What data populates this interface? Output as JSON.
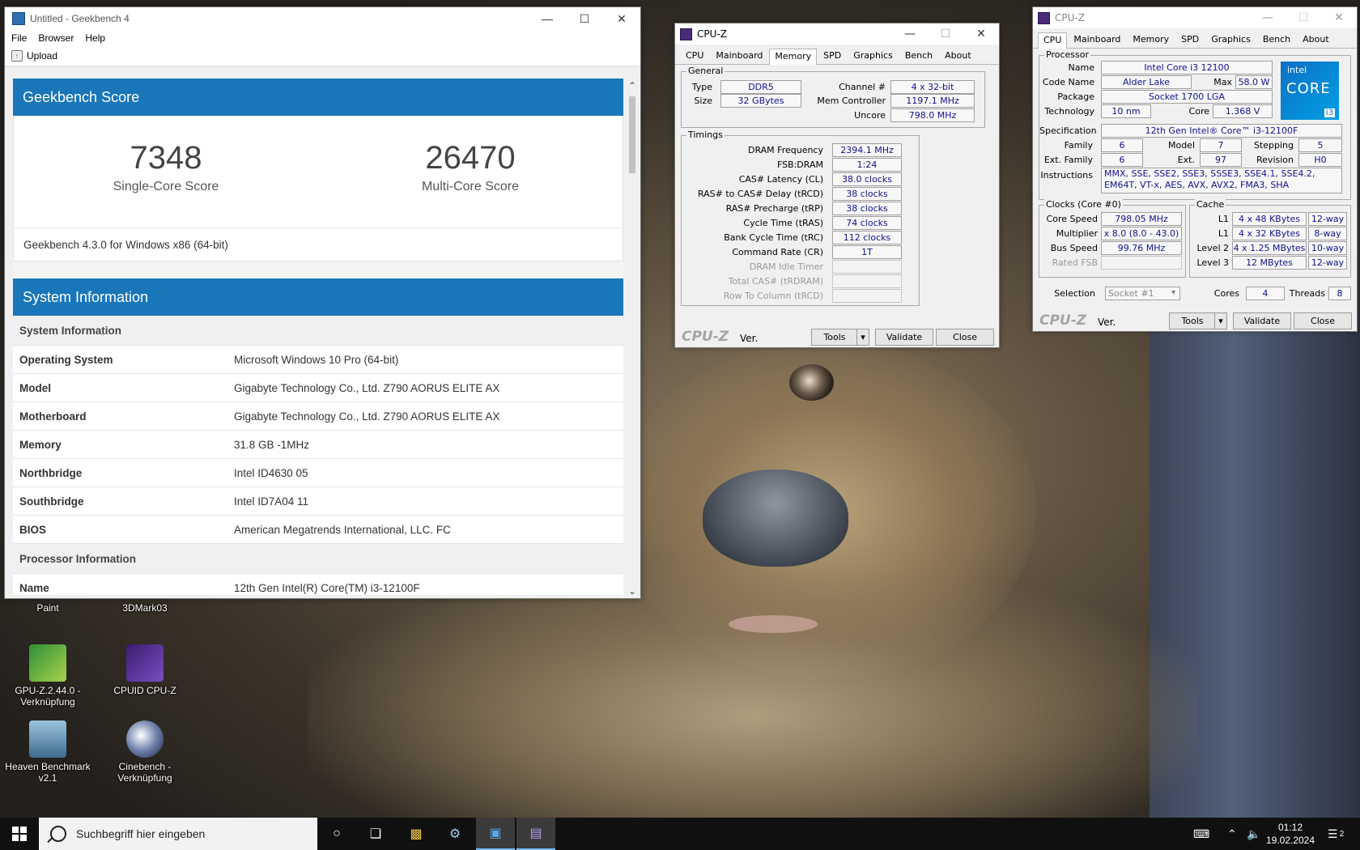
{
  "geekbench": {
    "window_title": "Untitled - Geekbench 4",
    "menu": [
      "File",
      "Browser",
      "Help"
    ],
    "upload_label": "Upload",
    "score_header": "Geekbench Score",
    "single_core_value": "7348",
    "single_core_label": "Single-Core Score",
    "multi_core_value": "26470",
    "multi_core_label": "Multi-Core Score",
    "version_text": "Geekbench 4.3.0 for Windows x86 (64-bit)",
    "sysinfo_header": "System Information",
    "sysinfo_group": "System Information",
    "rows": [
      {
        "key": "Operating System",
        "value": "Microsoft Windows 10 Pro (64-bit)"
      },
      {
        "key": "Model",
        "value": "Gigabyte Technology Co., Ltd. Z790 AORUS ELITE AX"
      },
      {
        "key": "Motherboard",
        "value": "Gigabyte Technology Co., Ltd. Z790 AORUS ELITE AX"
      },
      {
        "key": "Memory",
        "value": "31.8 GB -1MHz"
      },
      {
        "key": "Northbridge",
        "value": "Intel ID4630 05"
      },
      {
        "key": "Southbridge",
        "value": "Intel ID7A04 11"
      },
      {
        "key": "BIOS",
        "value": "American Megatrends International, LLC. FC"
      }
    ],
    "processor_group": "Processor Information",
    "processor_name_key": "Name",
    "processor_name_value": "12th Gen Intel(R) Core(TM) i3-12100F"
  },
  "cpuz_memory": {
    "title": "CPU-Z",
    "tabs": [
      "CPU",
      "Mainboard",
      "Memory",
      "SPD",
      "Graphics",
      "Bench",
      "About"
    ],
    "general_legend": "General",
    "type_label": "Type",
    "type_value": "DDR5",
    "size_label": "Size",
    "size_value": "32 GBytes",
    "channel_label": "Channel #",
    "channel_value": "4 x 32-bit",
    "memctrl_label": "Mem Controller",
    "memctrl_value": "1197.1 MHz",
    "uncore_label": "Uncore",
    "uncore_value": "798.0 MHz",
    "timings_legend": "Timings",
    "timings": [
      {
        "label": "DRAM Frequency",
        "value": "2394.1 MHz",
        "enabled": true
      },
      {
        "label": "FSB:DRAM",
        "value": "1:24",
        "enabled": true
      },
      {
        "label": "CAS# Latency (CL)",
        "value": "38.0 clocks",
        "enabled": true
      },
      {
        "label": "RAS# to CAS# Delay (tRCD)",
        "value": "38 clocks",
        "enabled": true
      },
      {
        "label": "RAS# Precharge (tRP)",
        "value": "38 clocks",
        "enabled": true
      },
      {
        "label": "Cycle Time (tRAS)",
        "value": "74 clocks",
        "enabled": true
      },
      {
        "label": "Bank Cycle Time (tRC)",
        "value": "112 clocks",
        "enabled": true
      },
      {
        "label": "Command Rate (CR)",
        "value": "1T",
        "enabled": true
      },
      {
        "label": "DRAM Idle Timer",
        "value": "",
        "enabled": false
      },
      {
        "label": "Total CAS# (tRDRAM)",
        "value": "",
        "enabled": false
      },
      {
        "label": "Row To Column (tRCD)",
        "value": "",
        "enabled": false
      }
    ],
    "logo": "CPU-Z",
    "ver_label": "Ver.",
    "tools_label": "Tools",
    "validate_label": "Validate",
    "close_label": "Close"
  },
  "cpuz_cpu": {
    "title": "CPU-Z",
    "tabs": [
      "CPU",
      "Mainboard",
      "Memory",
      "SPD",
      "Graphics",
      "Bench",
      "About"
    ],
    "processor_legend": "Processor",
    "name_label": "Name",
    "name_value": "Intel Core i3 12100",
    "codename_label": "Code Name",
    "codename_value": "Alder Lake",
    "maxtdp_label": "Max",
    "maxtdp_value": "58.0 W",
    "package_label": "Package",
    "package_value": "Socket 1700 LGA",
    "technology_label": "Technology",
    "technology_value": "10 nm",
    "corev_label": "Core",
    "corev_value": "1.368 V",
    "spec_label": "Specification",
    "spec_value": "12th Gen Intel® Core™ i3-12100F",
    "family_label": "Family",
    "family_value": "6",
    "model_label": "Model",
    "model_value": "7",
    "stepping_label": "Stepping",
    "stepping_value": "5",
    "extfamily_label": "Ext. Family",
    "extfamily_value": "6",
    "extmodel_label": "Ext.",
    "extmodel_value": "97",
    "revision_label": "Revision",
    "revision_value": "H0",
    "instr_label": "Instructions",
    "instr_line1": "MMX, SSE, SSE2, SSE3, SSSE3, SSE4.1, SSE4.2,",
    "instr_line2": "EM64T, VT-x, AES, AVX, AVX2, FMA3, SHA",
    "badge_brand": "intel",
    "badge_line": "CORE",
    "badge_tier": "i3",
    "clocks_legend": "Clocks (Core #0)",
    "corespeed_label": "Core Speed",
    "corespeed_value": "798.05 MHz",
    "multiplier_label": "Multiplier",
    "multiplier_value": "x 8.0 (8.0 - 43.0)",
    "busspeed_label": "Bus Speed",
    "busspeed_value": "99.76 MHz",
    "ratedfsb_label": "Rated FSB",
    "cache_legend": "Cache",
    "cache": [
      {
        "label": "L1",
        "size": "4 x 48 KBytes",
        "way": "12-way"
      },
      {
        "label": "L1",
        "size": "4 x 32 KBytes",
        "way": "8-way"
      },
      {
        "label": "Level 2",
        "size": "4 x 1.25 MBytes",
        "way": "10-way"
      },
      {
        "label": "Level 3",
        "size": "12 MBytes",
        "way": "12-way"
      }
    ],
    "selection_label": "Selection",
    "selection_value": "Socket #1",
    "cores_label": "Cores",
    "cores_value": "4",
    "threads_label": "Threads",
    "threads_value": "8",
    "logo": "CPU-Z",
    "ver_label": "Ver.",
    "tools_label": "Tools",
    "validate_label": "Validate",
    "close_label": "Close"
  },
  "desktop_icons": [
    {
      "label": "Paint"
    },
    {
      "label": "3DMark03"
    },
    {
      "label": "GPU-Z.2.44.0 - Verknüpfung"
    },
    {
      "label": "CPUID CPU-Z"
    },
    {
      "label": "Heaven Benchmark v2.1"
    },
    {
      "label": "Cinebench - Verknüpfung"
    }
  ],
  "taskbar": {
    "search_placeholder": "Suchbegriff hier eingeben",
    "time": "01:12",
    "date": "19.02.2024",
    "notification_count": "2"
  }
}
